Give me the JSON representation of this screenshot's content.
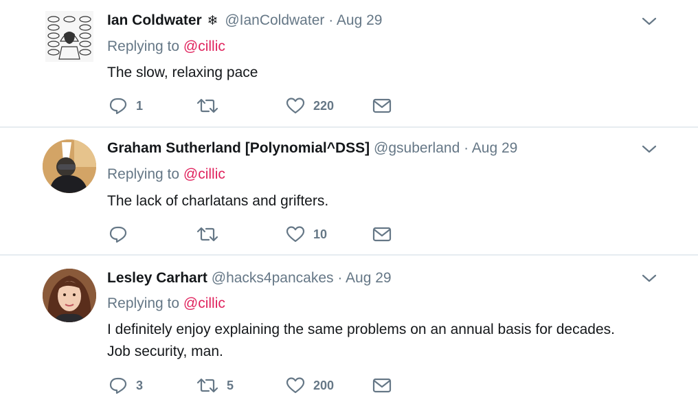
{
  "tweets": [
    {
      "name": "Ian Coldwater",
      "badge": "❄",
      "handle": "@IanColdwater",
      "date": "· Aug 29",
      "replying_prefix": "Replying to",
      "replying_to": "@cillic",
      "text_lines": [
        "The slow, relaxing pace"
      ],
      "replies": "1",
      "retweets": "",
      "likes": "220"
    },
    {
      "name": "Graham Sutherland [Polynomial^DSS]",
      "handle": "@gsuberland",
      "date": "· Aug 29",
      "replying_prefix": "Replying to",
      "replying_to": "@cillic",
      "text_lines": [
        "The lack of charlatans and grifters."
      ],
      "replies": "",
      "retweets": "",
      "likes": "10"
    },
    {
      "name": "Lesley Carhart",
      "handle": "@hacks4pancakes",
      "date": "· Aug 29",
      "replying_prefix": "Replying to",
      "replying_to": "@cillic",
      "text_lines": [
        "I definitely enjoy explaining the same problems on an annual basis for decades.",
        "Job security, man."
      ],
      "replies": "3",
      "retweets": "5",
      "likes": "200"
    }
  ],
  "colors": {
    "mention": "#e0245e",
    "muted": "#657786",
    "divider": "#e6ecf0"
  },
  "icons": [
    "reply-icon",
    "retweet-icon",
    "like-icon",
    "dm-icon",
    "chevron-down-icon"
  ]
}
